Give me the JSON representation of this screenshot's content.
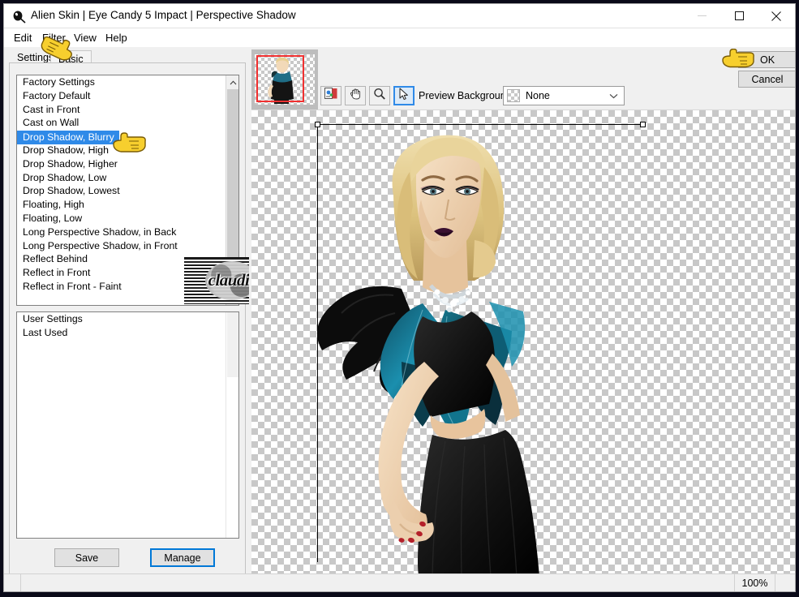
{
  "window": {
    "title": "Alien Skin | Eye Candy 5 Impact | Perspective Shadow",
    "app_icon": "alien-skin-icon",
    "controls": {
      "minimize": "minimize-icon",
      "maximize": "maximize-icon",
      "close": "close-icon"
    }
  },
  "menubar": {
    "items": [
      {
        "label": "Edit"
      },
      {
        "label": "Filter"
      },
      {
        "label": "View"
      },
      {
        "label": "Help"
      }
    ]
  },
  "tabs": [
    {
      "label": "Settings",
      "active": true
    },
    {
      "label": "Basic",
      "active": false
    }
  ],
  "settings_panel": {
    "factory_list": {
      "scrollbar_up_icon": "chevron-up-icon",
      "items": [
        {
          "label": "Factory Settings",
          "selected": false
        },
        {
          "label": "Factory Default",
          "selected": false
        },
        {
          "label": "Cast in Front",
          "selected": false
        },
        {
          "label": "Cast on Wall",
          "selected": false
        },
        {
          "label": "Drop Shadow, Blurry",
          "selected": true
        },
        {
          "label": "Drop Shadow, High",
          "selected": false
        },
        {
          "label": "Drop Shadow, Higher",
          "selected": false
        },
        {
          "label": "Drop Shadow, Low",
          "selected": false
        },
        {
          "label": "Drop Shadow, Lowest",
          "selected": false
        },
        {
          "label": "Floating, High",
          "selected": false
        },
        {
          "label": "Floating, Low",
          "selected": false
        },
        {
          "label": "Long Perspective Shadow, in Back",
          "selected": false
        },
        {
          "label": "Long Perspective Shadow, in Front",
          "selected": false
        },
        {
          "label": "Reflect Behind",
          "selected": false
        },
        {
          "label": "Reflect in Front",
          "selected": false
        },
        {
          "label": "Reflect in Front - Faint",
          "selected": false
        }
      ]
    },
    "user_list": {
      "items": [
        {
          "label": "User Settings"
        },
        {
          "label": "Last Used"
        }
      ]
    },
    "buttons": {
      "save": "Save",
      "manage": "Manage"
    }
  },
  "watermark": {
    "text": "claudia"
  },
  "preview_toolbar": {
    "tools": [
      {
        "name": "preview-compare-icon"
      },
      {
        "name": "hand-pan-icon"
      },
      {
        "name": "magnifier-zoom-icon"
      },
      {
        "name": "arrow-select-icon",
        "active": true
      }
    ],
    "background_label": "Preview Background:",
    "background_value": "None",
    "background_swatch": "checkerboard-swatch",
    "dropdown_icon": "chevron-down-icon"
  },
  "dialog_buttons": {
    "ok": "OK",
    "cancel": "Cancel"
  },
  "statusbar": {
    "message": "",
    "zoom": "100%"
  },
  "colors": {
    "selection_blue": "#2f8ae8",
    "focus_blue": "#0078d7",
    "thumbnail_marquee_red": "#f03030",
    "window_bg": "#f0f0f0",
    "list_bg": "#ffffff"
  },
  "annotations": {
    "pointer_tab": "pointing-hand-cursor",
    "pointer_list": "pointing-hand-cursor",
    "pointer_ok": "pointing-hand-cursor"
  }
}
